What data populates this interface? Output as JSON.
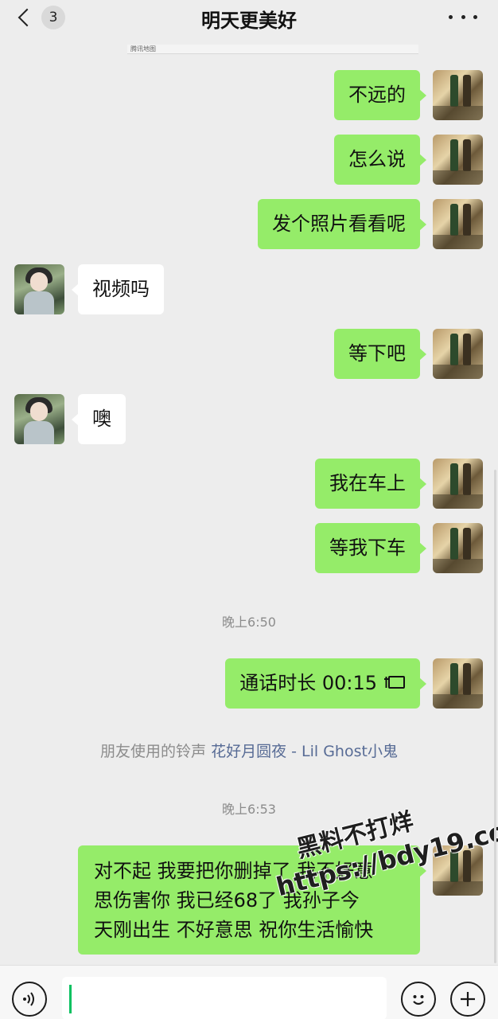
{
  "header": {
    "title": "明天更美好",
    "unread_count": "3"
  },
  "map_preview": {
    "label": "腾讯地图"
  },
  "messages": [
    {
      "side": "right",
      "text": "不远的"
    },
    {
      "side": "right",
      "text": "怎么说"
    },
    {
      "side": "right",
      "text": "发个照片看看呢"
    },
    {
      "side": "left",
      "text": "视频吗"
    },
    {
      "side": "right",
      "text": "等下吧"
    },
    {
      "side": "left",
      "text": "噢"
    },
    {
      "side": "right",
      "text": "我在车上"
    },
    {
      "side": "right",
      "text": "等我下车"
    },
    {
      "side": "right",
      "text": "通话时长 00:15"
    },
    {
      "side": "right",
      "lines": [
        "对不起 我要把你删掉了 我不好意",
        "思伤害你 我已经68了 我孙子今",
        "天刚出生 不好意思 祝你生活愉快"
      ]
    }
  ],
  "timestamps": [
    "晚上6:50",
    "晚上6:53"
  ],
  "ringtone": {
    "prefix": "朋友使用的铃声",
    "song": "花好月圆夜 - Lil Ghost小鬼"
  },
  "watermark": {
    "line1": "黑料不打烊",
    "line2": "https://bdy19.co"
  },
  "icons": {
    "back": "chevron-left-icon",
    "more": "more-dots-icon",
    "voice": "voice-icon",
    "emoji": "emoji-icon",
    "plus": "plus-icon",
    "call": "voice-call-icon"
  },
  "colors": {
    "sent_bubble": "#95ec69",
    "received_bubble": "#ffffff",
    "background": "#ededed",
    "link": "#576b95",
    "caret": "#07c160"
  }
}
